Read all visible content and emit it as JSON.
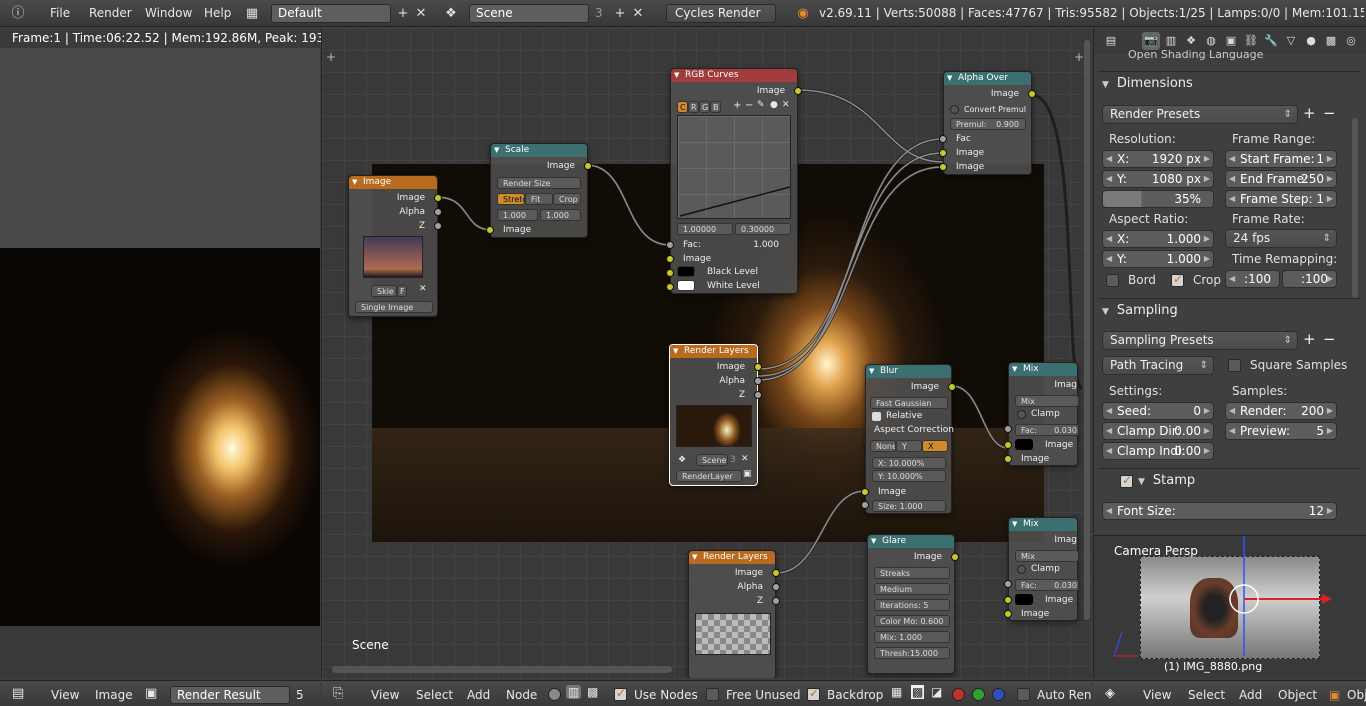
{
  "topbar": {
    "info_icon": "info-icon",
    "menus": [
      "File",
      "Render",
      "Window",
      "Help"
    ],
    "screen_layout": "Default",
    "scene": "Scene",
    "scene_users": "3",
    "render_engine": "Cycles Render",
    "stats": "v2.69.11 | Verts:50088 | Faces:47767 | Tris:95582 | Objects:1/25 | Lamps:0/0 | Mem:101.15M | IMG_8880"
  },
  "image_editor": {
    "status": "Frame:1 | Time:06:22.52 | Mem:192.86M, Peak: 193.97M",
    "footer": {
      "view": "View",
      "image": "Image",
      "image_name": "Render Result",
      "slot": "5"
    }
  },
  "node_editor": {
    "scene_label": "Scene",
    "nodes": {
      "image": {
        "title": "Image",
        "outputs": [
          "Image",
          "Alpha",
          "Z"
        ],
        "image_name": "Skie",
        "fake_user": "F",
        "source": "Single Image"
      },
      "scale": {
        "title": "Scale",
        "output": "Image",
        "space": "Render Size",
        "buttons": [
          "Stretc",
          "Fit",
          "Crop"
        ],
        "x": "1.000",
        "y": "1.000",
        "input": "Image"
      },
      "rgb_curves": {
        "title": "RGB Curves",
        "output": "Image",
        "channels": [
          "C",
          "R",
          "G",
          "B"
        ],
        "min": "1.00000",
        "max": "0.30000",
        "fac_label": "Fac:",
        "fac_value": "1.000",
        "inputs": [
          "Image",
          "Black Level",
          "White Level"
        ]
      },
      "alpha_over": {
        "title": "Alpha Over",
        "output": "Image",
        "convert_premul": "Convert Premul",
        "premul_label": "Premul:",
        "premul_value": "0.900",
        "inputs": [
          "Fac",
          "Image",
          "Image"
        ]
      },
      "render_layers_1": {
        "title": "Render Layers",
        "outputs": [
          "Image",
          "Alpha",
          "Z"
        ],
        "scene": "Scene",
        "scene_users": "3",
        "layer": "RenderLayer"
      },
      "blur": {
        "title": "Blur",
        "output": "Image",
        "filter": "Fast Gaussian",
        "relative": "Relative",
        "aspect": "Aspect Correction",
        "axes": [
          "None",
          "Y",
          "X"
        ],
        "x_pct": "X:       10.000%",
        "y_pct": "Y:       10.000%",
        "input": "Image",
        "size": "Size:         1.000"
      },
      "mix_1": {
        "title": "Mix",
        "output": "Imag",
        "mode": "Mix",
        "clamp": "Clamp",
        "fac": "Fac:",
        "fac_value": "0.030",
        "inputs": [
          "Image",
          "Image"
        ]
      },
      "render_layers_2": {
        "title": "Render Layers",
        "outputs": [
          "Image",
          "Alpha",
          "Z"
        ]
      },
      "glare": {
        "title": "Glare",
        "output": "Image",
        "type": "Streaks",
        "quality": "Medium",
        "iterations": "Iterations:      5",
        "color_mod": "Color Mo: 0.600",
        "mix": "Mix:            1.000",
        "threshold": "Thresh:15.000"
      },
      "mix_2": {
        "title": "Mix",
        "output": "Imag",
        "mode": "Mix",
        "clamp": "Clamp",
        "fac": "Fac:",
        "fac_value": "0.030",
        "inputs": [
          "Image",
          "Image"
        ]
      }
    },
    "footer": {
      "menus": [
        "View",
        "Select",
        "Add",
        "Node"
      ],
      "use_nodes": "Use Nodes",
      "free_unused": "Free Unused",
      "backdrop": "Backdrop",
      "auto_render": "Auto Rende"
    }
  },
  "properties": {
    "open_shading": "Open Shading Language",
    "dimensions": {
      "title": "Dimensions",
      "presets": "Render Presets",
      "resolution_label": "Resolution:",
      "res_x_label": "X:",
      "res_x": "1920 px",
      "res_y_label": "Y:",
      "res_y": "1080 px",
      "res_pct": "35%",
      "frame_range_label": "Frame Range:",
      "start_label": "Start Frame:",
      "start": "1",
      "end_label": "End Frame:",
      "end": "250",
      "step_label": "Frame Step:",
      "step": "1",
      "aspect_label": "Aspect Ratio:",
      "asp_x_label": "X:",
      "asp_x": "1.000",
      "asp_y_label": "Y:",
      "asp_y": "1.000",
      "frame_rate_label": "Frame Rate:",
      "frame_rate": "24 fps",
      "time_remap_label": "Time Remapping:",
      "remap_old": ":100",
      "remap_new": ":100",
      "border": "Bord",
      "crop": "Crop"
    },
    "sampling": {
      "title": "Sampling",
      "presets": "Sampling Presets",
      "integrator": "Path Tracing",
      "square_samples": "Square Samples",
      "settings_label": "Settings:",
      "seed_label": "Seed:",
      "seed": "0",
      "clamp_dir_label": "Clamp Dir:",
      "clamp_dir": "0.00",
      "clamp_ind_label": "Clamp Indi:",
      "clamp_ind": "0.00",
      "samples_label": "Samples:",
      "render_label": "Render:",
      "render": "200",
      "preview_label": "Preview:",
      "preview": "5"
    },
    "stamp": {
      "title": "Stamp",
      "font_size_label": "Font Size:",
      "font_size": "12"
    }
  },
  "view3d": {
    "label": "Camera Persp",
    "object_name": "(1) IMG_8880.png",
    "footer": {
      "menus": [
        "View",
        "Select",
        "Add",
        "Object"
      ],
      "mode": "Obj"
    }
  },
  "colors": {
    "node_orange": "#b86a1e",
    "node_teal": "#3c6f6f",
    "node_red": "#a23b3b",
    "socket_yellow": "#c7c729",
    "checkbox_check": "#c07020"
  }
}
